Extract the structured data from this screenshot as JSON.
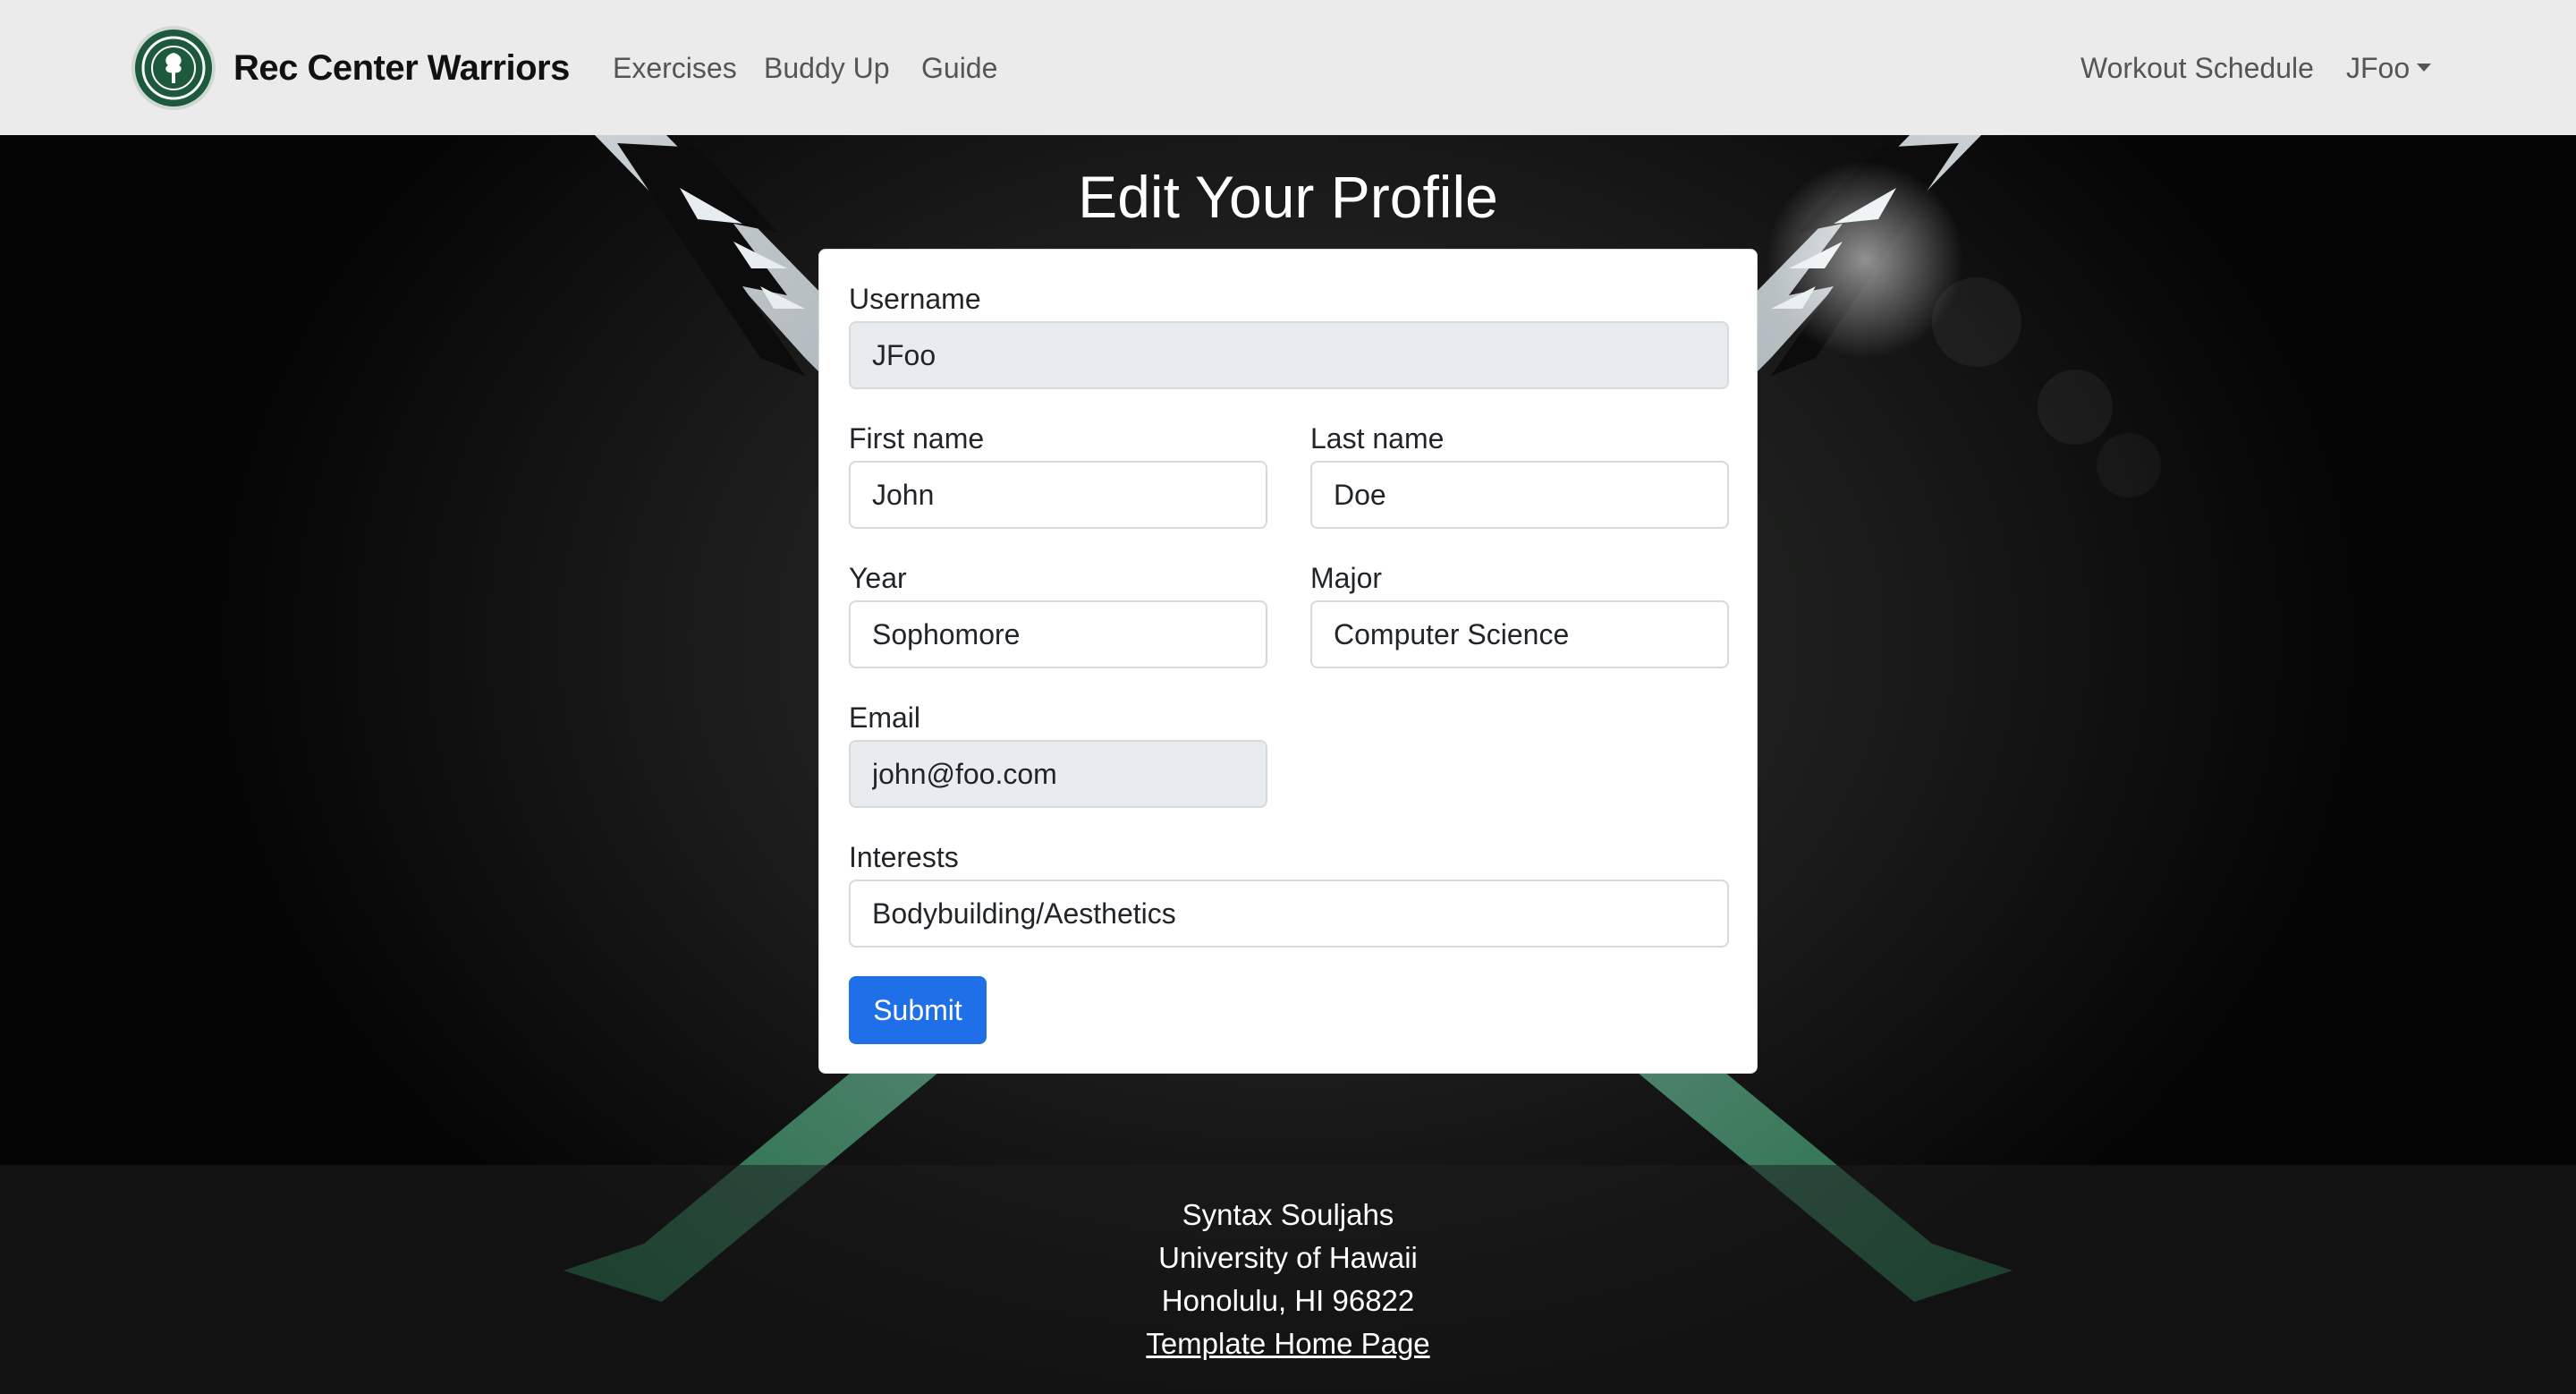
{
  "navbar": {
    "brand": "Rec Center Warriors",
    "links": [
      "Exercises",
      "Buddy Up",
      "Guide"
    ],
    "right_links": [
      "Workout Schedule"
    ],
    "user_menu": "JFoo"
  },
  "page": {
    "title": "Edit Your Profile"
  },
  "form": {
    "username": {
      "label": "Username",
      "value": "JFoo"
    },
    "first_name": {
      "label": "First name",
      "value": "John"
    },
    "last_name": {
      "label": "Last name",
      "value": "Doe"
    },
    "year": {
      "label": "Year",
      "value": "Sophomore"
    },
    "major": {
      "label": "Major",
      "value": "Computer Science"
    },
    "email": {
      "label": "Email",
      "value": "john@foo.com"
    },
    "interests": {
      "label": "Interests",
      "value": "Bodybuilding/Aesthetics"
    },
    "submit_label": "Submit"
  },
  "footer": {
    "lines": [
      "Syntax Souljahs",
      "University of Hawaii",
      "Honolulu, HI 96822"
    ],
    "link": "Template Home Page"
  },
  "colors": {
    "navbar_bg": "#ebebeb",
    "primary_button": "#1f6fe8",
    "logo_green": "#1d5a3c",
    "readonly_field": "#e9ecef"
  }
}
